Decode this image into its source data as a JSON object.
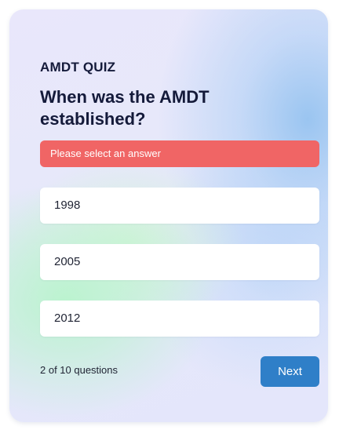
{
  "quiz": {
    "label": "AMDT QUIZ",
    "question": "When was the AMDT established?",
    "error_message": "Please select an answer",
    "options": [
      {
        "label": "1998"
      },
      {
        "label": "2005"
      },
      {
        "label": "2012"
      }
    ],
    "progress_text": "2 of 10 questions",
    "next_label": "Next"
  },
  "colors": {
    "error": "#f06565",
    "primary_button": "#2f7fc8",
    "text": "#141a3a"
  }
}
